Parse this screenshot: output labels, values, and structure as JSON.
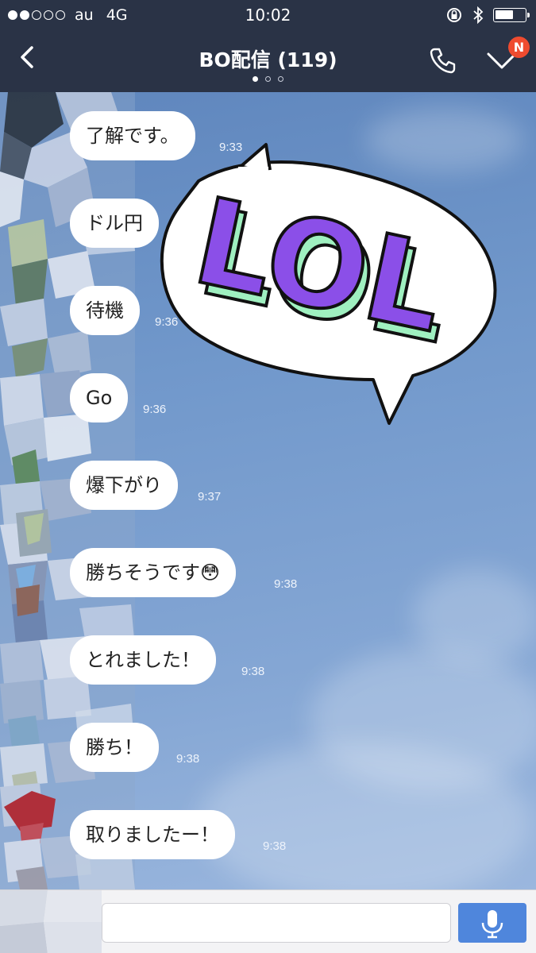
{
  "status": {
    "carrier": "au",
    "network": "4G",
    "time": "10:02"
  },
  "header": {
    "title": "BO配信 (119)",
    "badge": "N"
  },
  "messages": [
    {
      "text": "了解です。",
      "time": "9:33"
    },
    {
      "text": "ドル円",
      "time": ""
    },
    {
      "text": "待機",
      "time": "9:36"
    },
    {
      "text": "Go",
      "time": "9:36"
    },
    {
      "text": "爆下がり",
      "time": "9:37"
    },
    {
      "text": "勝ちそうです😳",
      "time": "9:38"
    },
    {
      "text": "とれました！",
      "time": "9:38"
    },
    {
      "text": "勝ち！",
      "time": "9:38"
    },
    {
      "text": "取りましたー！",
      "time": "9:38"
    }
  ],
  "sticker": {
    "text": "LOL",
    "colors": {
      "face": "#8b4fe8",
      "side": "#9ff0c0",
      "outline": "#111111"
    }
  },
  "input": {
    "placeholder": ""
  },
  "colors": {
    "header_bg": "#2a3346",
    "badge": "#ef4b2f",
    "mic_button": "#4f86dc"
  }
}
